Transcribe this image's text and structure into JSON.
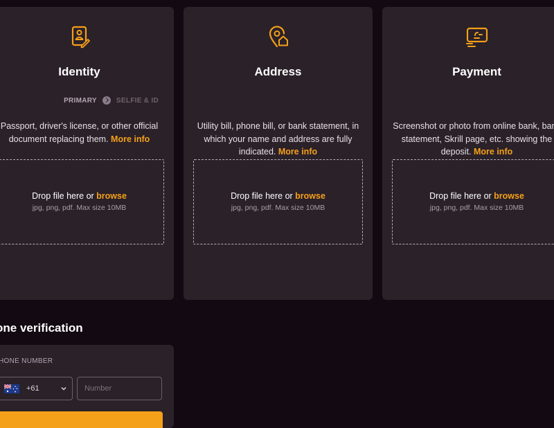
{
  "colors": {
    "accent": "#f5a019",
    "background": "#120912",
    "card": "#2a2129"
  },
  "cards": {
    "identity": {
      "icon": "id-document-icon",
      "title": "Identity",
      "steps": [
        "PRIMARY",
        "SELFIE & ID"
      ],
      "description": "Passport, driver's license, or other official document replacing them.",
      "more_info": "More info",
      "drop_text": "Drop file here or",
      "browse": "browse",
      "hint": "jpg, png, pdf. Max size 10MB"
    },
    "address": {
      "icon": "location-home-icon",
      "title": "Address",
      "description": "Utility bill, phone bill, or bank statement, in which your name and address are fully indicated.",
      "more_info": "More info",
      "drop_text": "Drop file here or",
      "browse": "browse",
      "hint": "jpg, png, pdf. Max size 10MB"
    },
    "payment": {
      "icon": "payment-card-icon",
      "title": "Payment",
      "description": "Screenshot or photo from online bank, bank statement, Skrill page, etc. showing the deposit.",
      "more_info": "More info",
      "drop_text": "Drop file here or",
      "browse": "browse",
      "hint": "jpg, png, pdf. Max size 10MB"
    }
  },
  "phone": {
    "heading": "one verification",
    "label": "HONE NUMBER",
    "country_flag": "australia-flag-icon",
    "dial_code": "+61",
    "number_placeholder": "Number"
  }
}
